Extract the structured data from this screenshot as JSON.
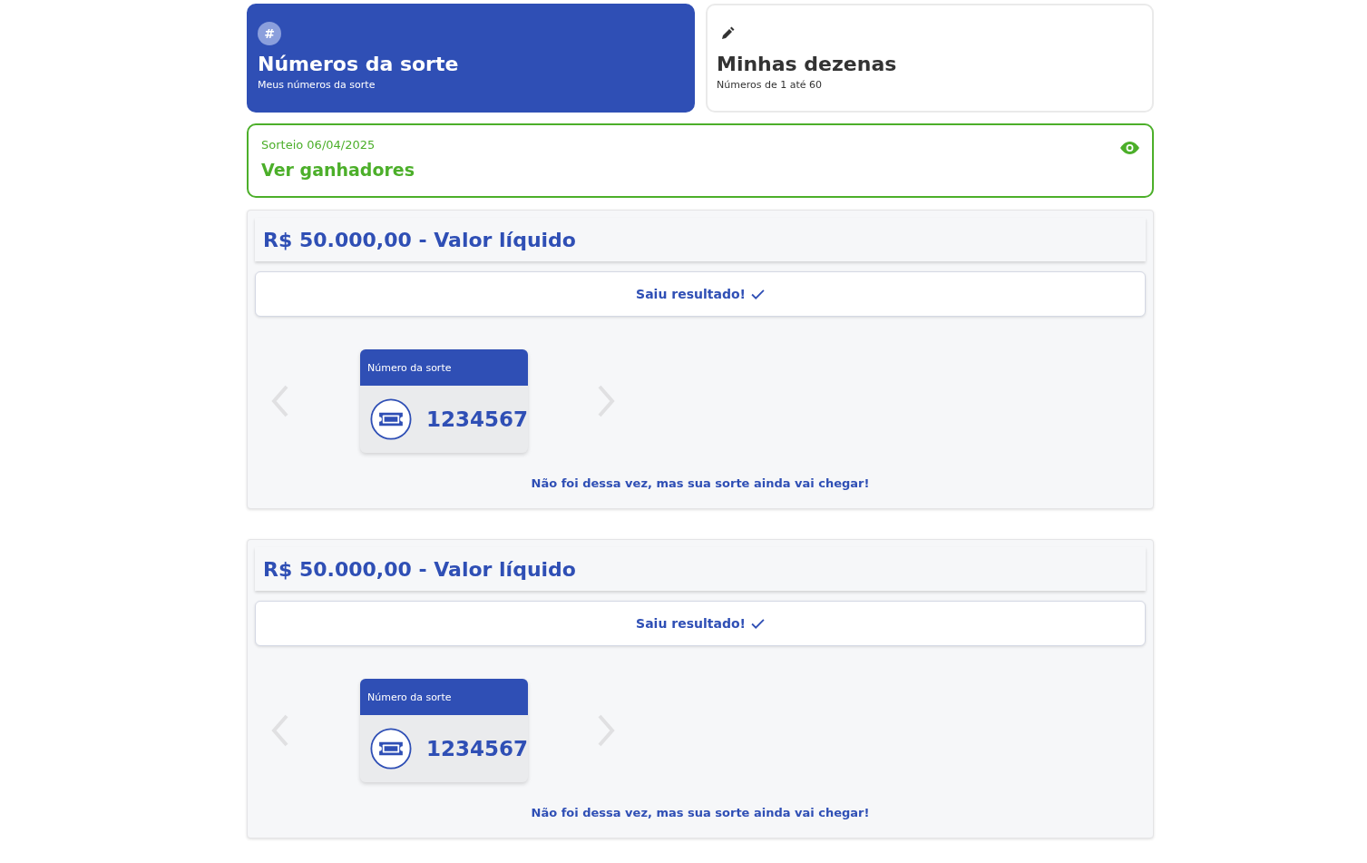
{
  "tabs": [
    {
      "title": "Números da sorte",
      "subtitle": "Meus números da sorte",
      "icon": "#",
      "selected": true
    },
    {
      "title": "Minhas dezenas",
      "subtitle": "Números de 1 até 60",
      "selected": false
    }
  ],
  "draw": {
    "date": "Sorteio 06/04/2025",
    "link": "Ver ganhadores"
  },
  "prizes": [
    {
      "title": "R$ 50.000,00 - Valor líquido",
      "result": "Saiu resultado!",
      "card_label": "Número da sorte",
      "number": "1234567",
      "message": "Não foi dessa vez, mas sua sorte ainda vai chegar!"
    },
    {
      "title": "R$ 50.000,00 - Valor líquido",
      "result": "Saiu resultado!",
      "card_label": "Número da sorte",
      "number": "1234567",
      "message": "Não foi dessa vez, mas sua sorte ainda vai chegar!"
    }
  ]
}
